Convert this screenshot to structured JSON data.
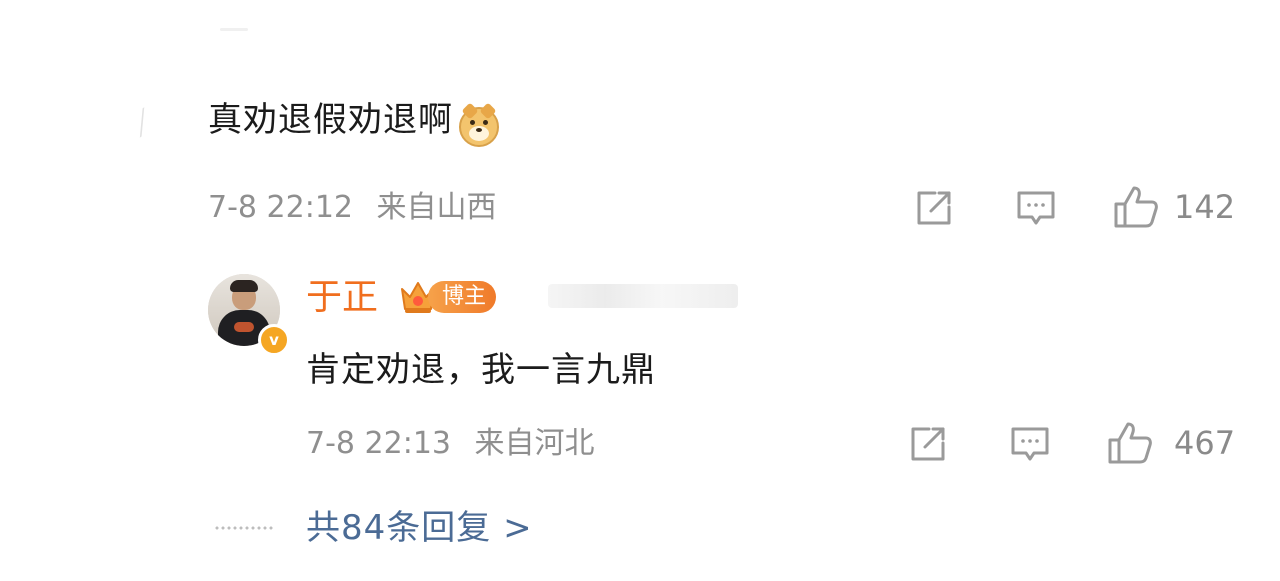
{
  "comment": {
    "text": "真劝退假劝退啊",
    "emoji_icon": "doge-emoji-icon",
    "time": "7-8 22:12",
    "location": "来自山西",
    "like_count": "142"
  },
  "reply": {
    "author": "于正",
    "badge_label": "博主",
    "verified_icon": "v-verified-icon",
    "text": "肯定劝退，我一言九鼎",
    "time": "7-8 22:13",
    "location": "来自河北",
    "like_count": "467"
  },
  "more_replies": {
    "label": "共84条回复 >"
  },
  "colors": {
    "author": "#f06e1e",
    "meta": "#8f8f8f",
    "link": "#4b6b95",
    "icon": "#9a9a9a"
  }
}
